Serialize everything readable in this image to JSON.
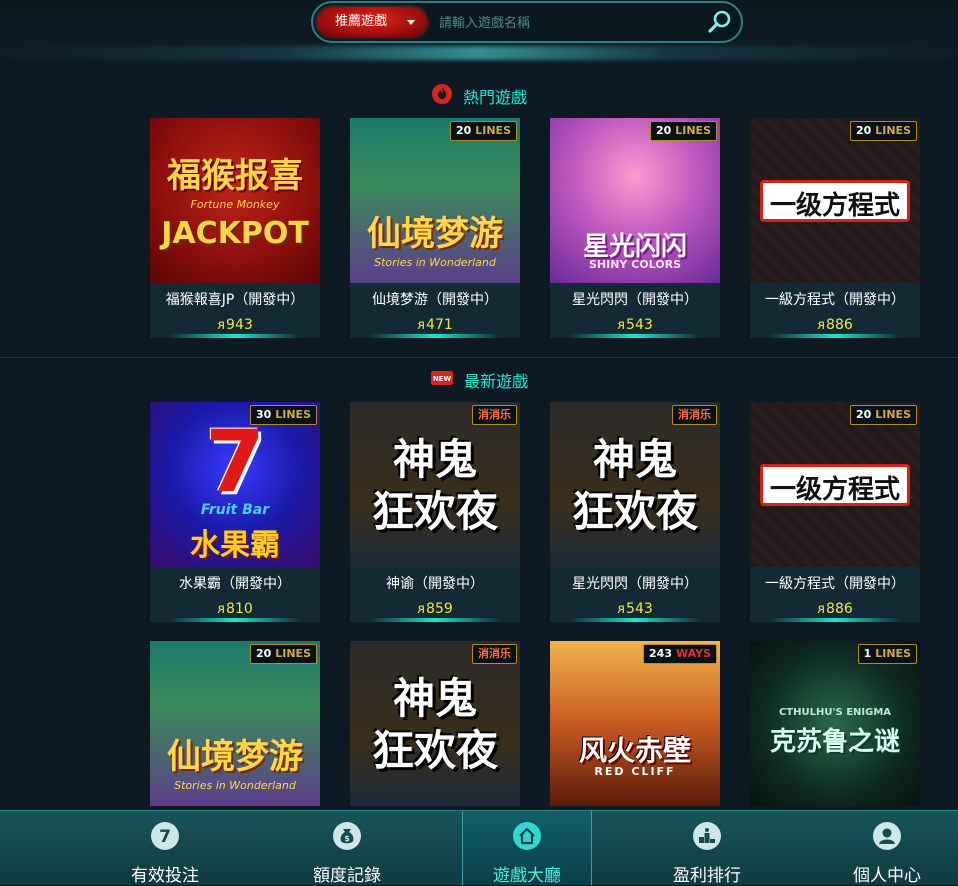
{
  "search": {
    "category": "推薦遊戲",
    "placeholder": "請輸入遊戲名稱"
  },
  "sections": {
    "hot": {
      "title": "熱門遊戲"
    },
    "new": {
      "title": "最新遊戲",
      "badge": "NEW"
    }
  },
  "hot_games": [
    {
      "name": "福猴報喜JP（開發中）",
      "amount": "943",
      "art_title": "福猴报喜",
      "art_sub1": "Fortune Monkey",
      "art_sub2": "JACKPOT"
    },
    {
      "name": "仙境梦游（開發中）",
      "amount": "471",
      "badge_n": "20",
      "badge_t": "LINES",
      "art_title": "仙境梦游",
      "art_sub": "Stories in Wonderland"
    },
    {
      "name": "星光閃閃（開發中）",
      "amount": "543",
      "badge_n": "20",
      "badge_t": "LINES",
      "art_title": "星光闪闪",
      "art_sub": "SHINY COLORS"
    },
    {
      "name": "一級方程式（開發中）",
      "amount": "886",
      "badge_n": "20",
      "badge_t": "LINES",
      "art_title": "一级方程式"
    }
  ],
  "new_games": [
    {
      "name": "水果霸（開發中）",
      "amount": "810",
      "badge_n": "30",
      "badge_t": "LINES",
      "art_title": "水果霸",
      "art_sub": "Fruit Bar"
    },
    {
      "name": "神谕（開發中）",
      "amount": "859",
      "badge_t": "消消乐",
      "art_title1": "神鬼",
      "art_title2": "狂欢夜"
    },
    {
      "name": "星光閃閃（開發中）",
      "amount": "543",
      "badge_t": "消消乐",
      "art_title1": "神鬼",
      "art_title2": "狂欢夜"
    },
    {
      "name": "一級方程式（開發中）",
      "amount": "886",
      "badge_n": "20",
      "badge_t": "LINES",
      "art_title": "一级方程式"
    }
  ],
  "more_games": [
    {
      "badge_n": "20",
      "badge_t": "LINES",
      "art_title": "仙境梦游",
      "art_sub": "Stories in Wonderland"
    },
    {
      "badge_t": "消消乐",
      "art_title1": "神鬼",
      "art_title2": "狂欢夜"
    },
    {
      "badge_n": "243",
      "badge_t": "WAYS",
      "art_title": "风火赤壁",
      "art_sub": "RED CLIFF"
    },
    {
      "badge_n": "1",
      "badge_t": "LINES",
      "art_title": "克苏鲁之谜",
      "art_sub": "CTHULHU'S ENIGMA"
    }
  ],
  "nav": [
    {
      "label": "有效投注",
      "icon": "seven-icon"
    },
    {
      "label": "額度記錄",
      "icon": "money-bag-icon"
    },
    {
      "label": "遊戲大廳",
      "icon": "home-icon",
      "active": true
    },
    {
      "label": "盈利排行",
      "icon": "podium-icon"
    },
    {
      "label": "個人中心",
      "icon": "user-icon"
    }
  ],
  "colors": {
    "accent": "#1ee8d4",
    "amount": "#f0e64a",
    "nav_bg": "#17555a"
  }
}
